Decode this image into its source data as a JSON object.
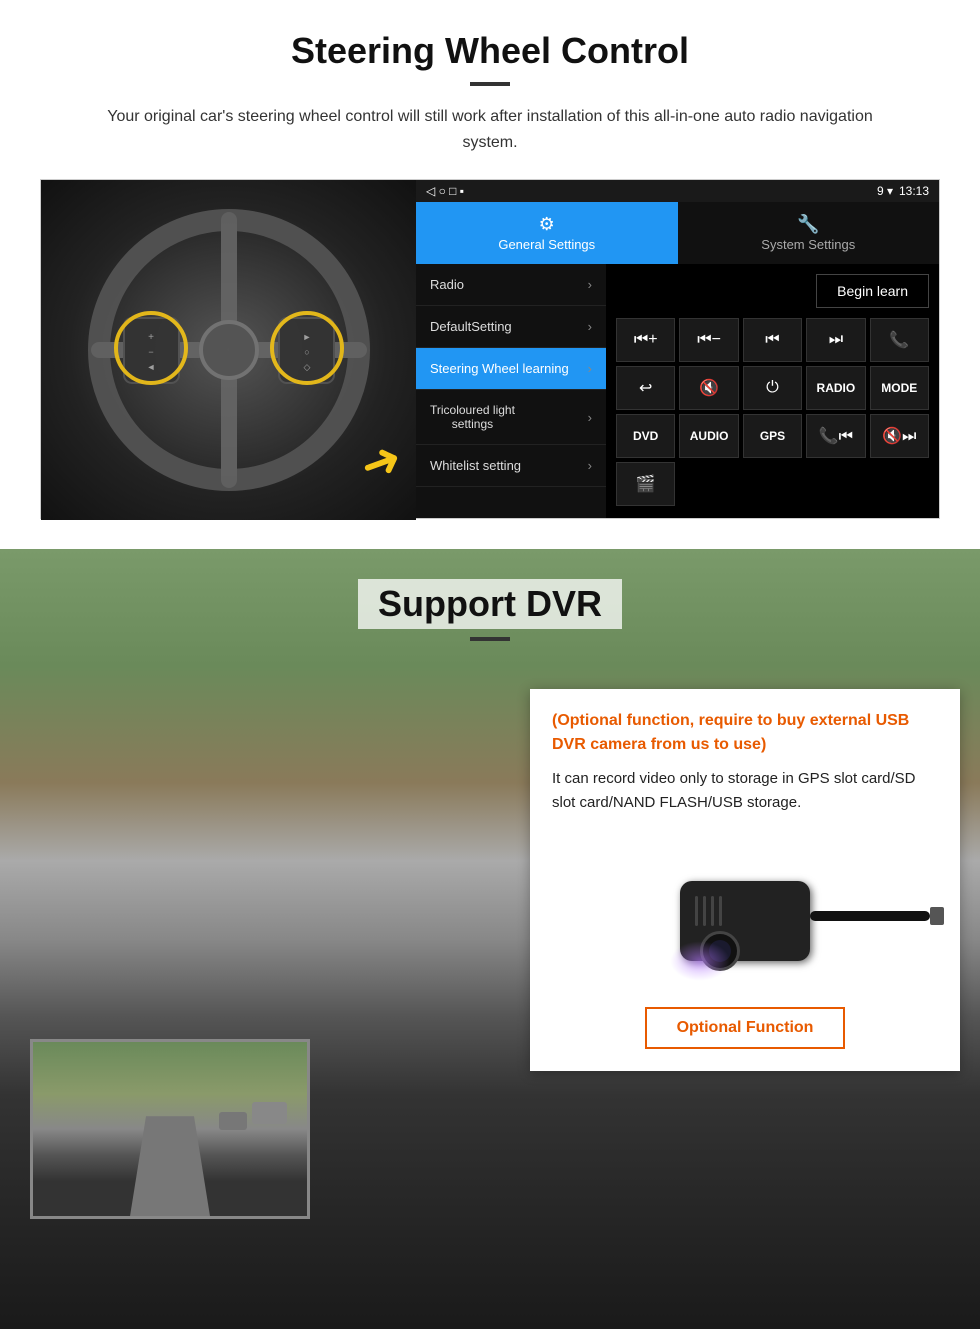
{
  "steering": {
    "title": "Steering Wheel Control",
    "subtitle": "Your original car's steering wheel control will still work after installation of this all-in-one auto radio navigation system.",
    "status_bar": {
      "time": "13:13",
      "icons": "9 ▾"
    },
    "tabs": {
      "active": {
        "icon": "⚙",
        "label": "General Settings"
      },
      "inactive": {
        "icon": "🔧",
        "label": "System Settings"
      }
    },
    "menu_items": [
      {
        "label": "Radio",
        "active": false
      },
      {
        "label": "DefaultSetting",
        "active": false
      },
      {
        "label": "Steering Wheel learning",
        "active": true
      },
      {
        "label": "Tricoloured light settings",
        "active": false
      },
      {
        "label": "Whitelist setting",
        "active": false
      }
    ],
    "begin_learn": "Begin learn",
    "control_buttons": [
      {
        "label": "⏮+",
        "type": "icon"
      },
      {
        "label": "⏮-",
        "type": "icon"
      },
      {
        "label": "⏮",
        "type": "icon"
      },
      {
        "label": "⏭",
        "type": "icon"
      },
      {
        "label": "📞",
        "type": "icon"
      },
      {
        "label": "↩",
        "type": "icon"
      },
      {
        "label": "🔇",
        "type": "icon"
      },
      {
        "label": "⏻",
        "type": "icon"
      },
      {
        "label": "RADIO",
        "type": "text"
      },
      {
        "label": "MODE",
        "type": "text"
      },
      {
        "label": "DVD",
        "type": "text"
      },
      {
        "label": "AUDIO",
        "type": "text"
      },
      {
        "label": "GPS",
        "type": "text"
      },
      {
        "label": "📞⏮",
        "type": "icon"
      },
      {
        "label": "🔇⏭",
        "type": "icon"
      },
      {
        "label": "🎬",
        "type": "icon"
      }
    ]
  },
  "dvr": {
    "title": "Support DVR",
    "info_orange": "(Optional function, require to buy external USB DVR camera from us to use)",
    "info_black": "It can record video only to storage in GPS slot card/SD slot card/NAND FLASH/USB storage.",
    "optional_button": "Optional Function"
  }
}
